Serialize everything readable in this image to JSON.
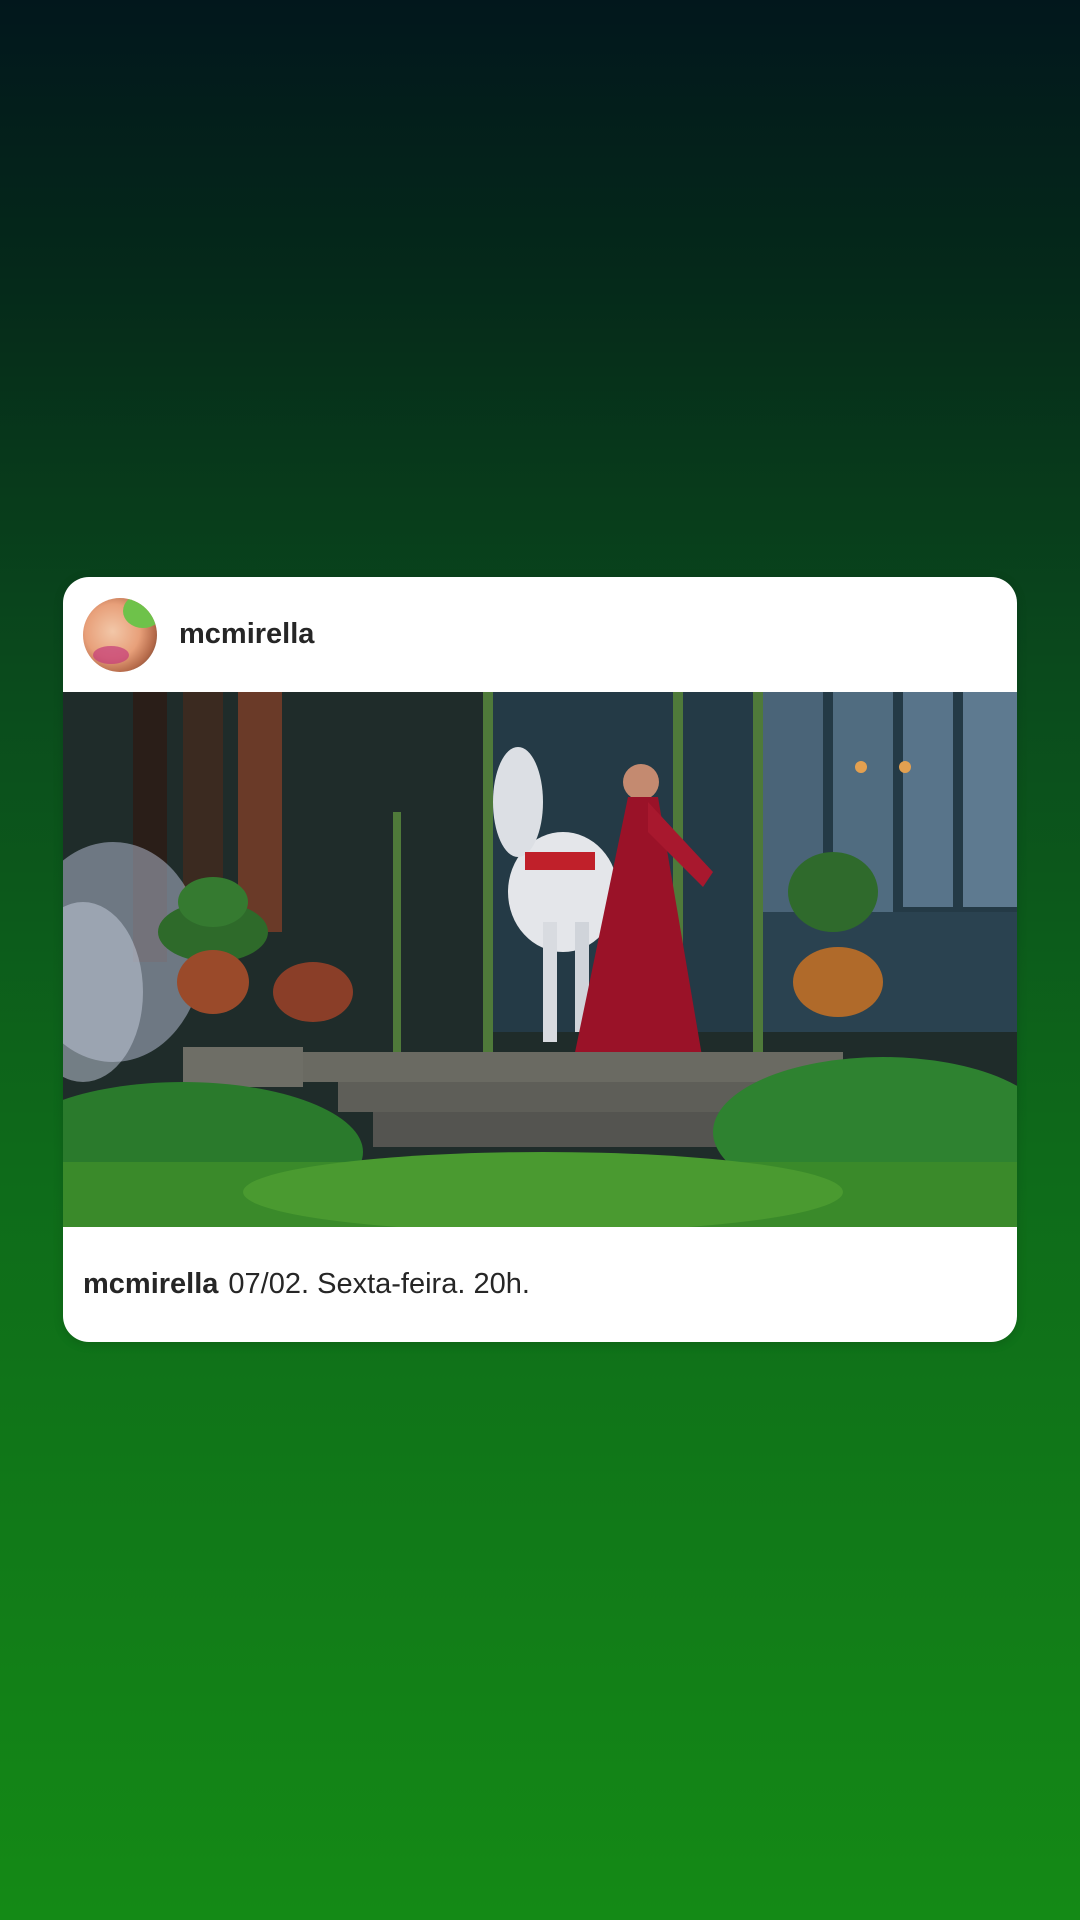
{
  "post": {
    "username": "mcmirella",
    "avatar_icon": "profile-avatar",
    "caption_user": "mcmirella",
    "caption_text": "07/02. Sexta-feira. 20h."
  },
  "colors": {
    "background_top": "#02171c",
    "background_bottom": "#148a16",
    "card": "#ffffff",
    "text": "#262626"
  }
}
